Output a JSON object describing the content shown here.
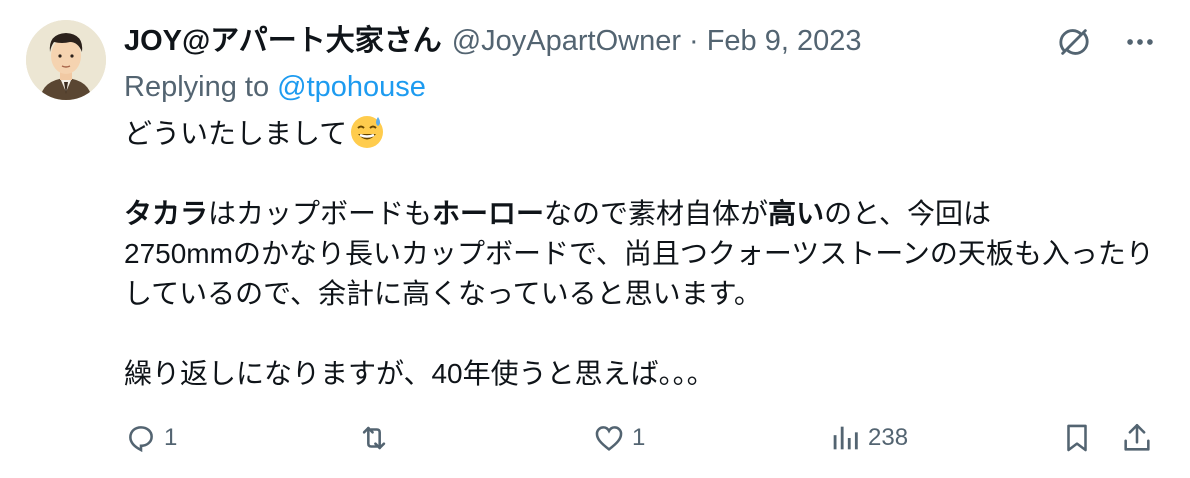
{
  "tweet": {
    "display_name": "JOY@アパート大家さん",
    "handle": "@JoyApartOwner",
    "separator": "·",
    "date": "Feb 9, 2023",
    "replying_prefix": "Replying to",
    "replying_mention": "@tpohouse",
    "line1": "どういたしまして",
    "p2": {
      "s1": "タカラ",
      "s2": "はカップボードも",
      "s3": "ホーロー",
      "s4": "なので素材自体が",
      "s5": "高い",
      "s6": "のと、今回は",
      "s7": "2750mmのかなり長いカップボードで、尚且つクォーツストーンの天板も入ったりしているので、余計に高くなっていると思います。"
    },
    "p3": "繰り返しになりますが、40年使うと思えば。。。",
    "emoji": "sweat-smile-emoji"
  },
  "actions": {
    "reply_count": "1",
    "like_count": "1",
    "view_count": "238"
  },
  "icons": {
    "grok": "grok-icon",
    "more": "more-icon",
    "reply": "reply-icon",
    "retweet": "retweet-icon",
    "like": "heart-icon",
    "views": "views-icon",
    "bookmark": "bookmark-icon",
    "share": "share-icon"
  },
  "colors": {
    "text": "#0f1419",
    "secondary": "#536471",
    "link": "#1d9bf0"
  }
}
